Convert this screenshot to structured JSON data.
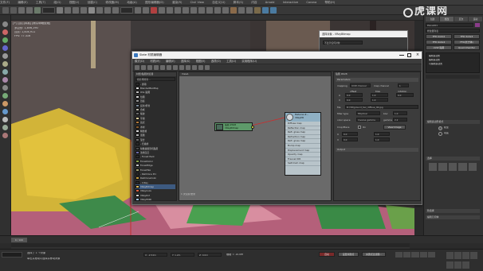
{
  "app": {
    "menubar": [
      "文件(F)",
      "编辑(E)",
      "工具(T)",
      "组(G)",
      "视图(V)",
      "创建(C)",
      "修改器(M)",
      "动画(A)",
      "图形编辑器(D)",
      "渲染(R)",
      "Civil View",
      "自定义(U)",
      "脚本(S)",
      "内容",
      "Arnold",
      "Interactive",
      "Corona",
      "帮助(H)"
    ],
    "watermark": "虎课网"
  },
  "viewport": {
    "label": "[+] [顶] [标准] [默认明暗处理]",
    "stats": [
      "多边形: 1,856,190",
      "顶点: 1,004,911",
      "FPS: 77.316"
    ]
  },
  "slate": {
    "title": "Slate 材质编辑器",
    "menu": [
      "模式(D)",
      "材质(M)",
      "编辑(E)",
      "选择(S)",
      "视图(V)",
      "选项(O)",
      "工具(U)",
      "实用程序(U)"
    ],
    "browser_header": "材质/贴图浏览器",
    "search_placeholder": "按名称搜索...",
    "browser_items": [
      {
        "label": "- 通用",
        "sw": "#2b2b2b"
      },
      {
        "label": "BlendedBoxMap",
        "sw": "#e0e0e0"
      },
      {
        "label": "OSL 贴图",
        "sw": "#c0c0c0"
      },
      {
        "label": "位图",
        "sw": "#d8d8d8"
      },
      {
        "label": "凹痕",
        "sw": "#9a9a9a"
      },
      {
        "label": "反射/折射",
        "sw": "#7a8a9a"
      },
      {
        "label": "合成",
        "sw": "#b7b6a8"
      },
      {
        "label": "噪波",
        "sw": "#6a6a6a"
      },
      {
        "label": "平铺",
        "sw": "#e5d5a0"
      },
      {
        "label": "斑点",
        "sw": "#b47a3a"
      },
      {
        "label": "木材",
        "sw": "#8a5a2a"
      },
      {
        "label": "棋盘格",
        "sw": "#dcdcdc"
      },
      {
        "label": "泼溅",
        "sw": "#b9b9b9"
      },
      {
        "label": "混合",
        "sw": "#6e6e6e"
      },
      {
        "label": "- 扫描线",
        "sw": "#2b2b2b"
      },
      {
        "label": "每像素摄影机贴图",
        "sw": "#4a4a4a"
      },
      {
        "label": "法线凹凸",
        "sw": "#6a6aaa"
      },
      {
        "label": "- Forest Pack",
        "sw": "#2b2b2b"
      },
      {
        "label": "ForestColor",
        "sw": "#8aa44a"
      },
      {
        "label": "ForestEdge",
        "sw": "#c7c7c7"
      },
      {
        "label": "ForestTex",
        "sw": "#a0a070"
      },
      {
        "label": "- RailClone Pro",
        "sw": "#2b2b2b"
      },
      {
        "label": "RailCloneColor",
        "sw": "#c8a040"
      },
      {
        "label": "- V-Ray",
        "sw": "#2b2b2b"
      },
      {
        "label": "VRayBitmap",
        "sw": "#e0c060"
      },
      {
        "label": "VRayColor",
        "sw": "#e06040"
      },
      {
        "label": "VRayDirt",
        "sw": "#d0d0d0"
      },
      {
        "label": "VRayHDRI",
        "sw": "#a0c0e0"
      }
    ],
    "view_tab": "View1",
    "nav_label": "1 次渲染/更新",
    "node_bitmap": {
      "line1": "贴图 #628",
      "line2": "VRayBitmap"
    },
    "node_material": {
      "line1": "Material #...",
      "line2": "VRayMtl",
      "slots": [
        "Diffuse map",
        "Reflection map",
        "Refl. gloss map",
        "Refraction map",
        "Refr. gloss map",
        "Bump map",
        "Displacement map",
        "Opacity map",
        "Fresnel IOR",
        "Self-illum map"
      ]
    },
    "params": {
      "header": "贴图 #628",
      "rollout1": "Parameters",
      "mapping_label": "mapping",
      "mapping_value": "UVW channel",
      "map_channel_label": "map channel",
      "map_channel_value": "1",
      "offset_label": "offset",
      "tiles_label": "tiles",
      "rotation_label": "rotation",
      "u_label": "U",
      "v_label": "V",
      "offset_u": "0.0",
      "offset_v": "0.0",
      "tiles_u": "1.0",
      "tiles_v": "1.0",
      "rot": "0.0",
      "file_label": "file",
      "file_value": "D:\\3D\\ground_tex_diffuse_4K.jpg",
      "filter_label": "filter type",
      "filter_value": "Elliptical",
      "blur_label": "blur",
      "blur_value": "1.0",
      "color_space_label": "color space",
      "color_space_value": "Inverse gamma",
      "gamma_label": "gamma",
      "gamma_value": "2.2",
      "crop_label": "Crop/Place",
      "crop_on": "On",
      "view_image": "View Image",
      "u_val": "0.0",
      "w_val": "1.0",
      "v_val": "0.0",
      "h_val": "1.0",
      "rollout2": "Output"
    }
  },
  "dialog2": {
    "title": "选择对象 - VRayBitmap",
    "dropdown": "不显示任何对象"
  },
  "cmdpanel": {
    "tabs": [
      "创建",
      "修改",
      "层次",
      "运动"
    ],
    "object_name": "Plane001",
    "modifier_list": "修改器列表",
    "buttons": [
      "FFD 2x2x2",
      "FFD 3x3x3",
      "FFD 4x4x4",
      "FFD(长方体)",
      "UVW 贴图",
      "Quad Chamfer"
    ],
    "stack": [
      "编辑多边形",
      "编辑多边形",
      "可编辑多边形"
    ],
    "rollout_select": "编辑多边形模式",
    "rollout_soft": "软选择",
    "options": [
      "模型",
      "动画"
    ],
    "select_label": "选择",
    "edit_label": "编辑几何体"
  },
  "bottom": {
    "frame": "0 / 100",
    "status1": "选择了 1 个对象",
    "status2": "单击并拖动以选择并移动对象",
    "x": "X: -2.54m",
    "y": "Y: 1.2m",
    "z": "Z: 0.0m",
    "grid": "栅格 = 10.0m",
    "autokey": "自动",
    "setkey": "设置关键点",
    "filter": "关键点过滤器..."
  }
}
